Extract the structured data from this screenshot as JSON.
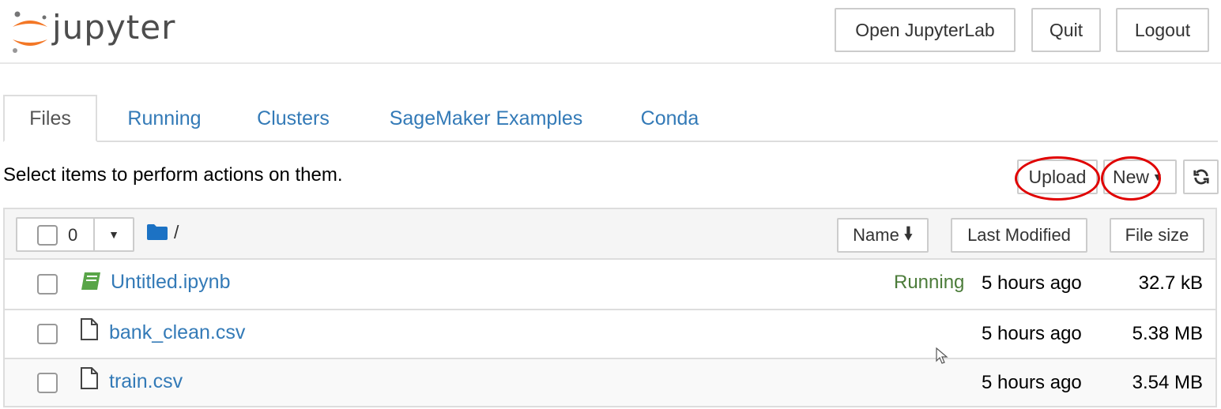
{
  "header": {
    "logo_text": "jupyter",
    "buttons": {
      "open_jupyterlab": "Open JupyterLab",
      "quit": "Quit",
      "logout": "Logout"
    }
  },
  "tabs": [
    {
      "label": "Files",
      "active": true
    },
    {
      "label": "Running",
      "active": false
    },
    {
      "label": "Clusters",
      "active": false
    },
    {
      "label": "SageMaker Examples",
      "active": false
    },
    {
      "label": "Conda",
      "active": false
    }
  ],
  "toolbar": {
    "hint": "Select items to perform actions on them.",
    "upload_label": "Upload",
    "new_label": "New",
    "refresh_icon": "refresh-icon"
  },
  "list_header": {
    "selected_count": "0",
    "path": "/",
    "sort_name_label": "Name",
    "sort_modified_label": "Last Modified",
    "sort_size_label": "File size"
  },
  "files": [
    {
      "name": "Untitled.ipynb",
      "type": "notebook",
      "status": "Running",
      "modified": "5 hours ago",
      "size": "32.7 kB"
    },
    {
      "name": "bank_clean.csv",
      "type": "file",
      "status": "",
      "modified": "5 hours ago",
      "size": "5.38 MB"
    },
    {
      "name": "train.csv",
      "type": "file",
      "status": "",
      "modified": "5 hours ago",
      "size": "3.54 MB"
    }
  ],
  "colors": {
    "link": "#337ab7",
    "running": "#4c7c3a",
    "logo_orange": "#f37726",
    "annotation_red": "#e00000",
    "folder_blue": "#1c72c4",
    "notebook_green": "#59a548"
  }
}
